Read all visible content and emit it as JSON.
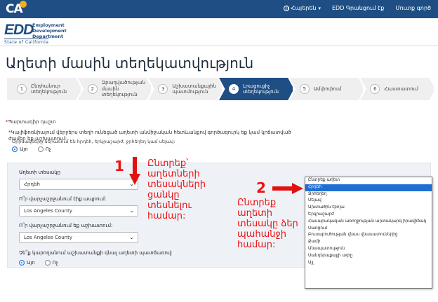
{
  "topbar": {
    "logo": "CA",
    "language": "Հայերեն",
    "my_account": "EDD Գրանցում էք",
    "login": "Մուտք գործ"
  },
  "header": {
    "edd_mark": "EDD",
    "edd_lines": [
      "Employment",
      "Development",
      "Department"
    ],
    "edd_state": "State of California"
  },
  "page": {
    "title": "Աղետի մասին տեղեկատվություն"
  },
  "steps": [
    {
      "num": "1",
      "label": "Ընդհանուր տեղեկություն",
      "active": false
    },
    {
      "num": "2",
      "label": "Զբաղվածության մասին տեղեկություն",
      "active": false
    },
    {
      "num": "3",
      "label": "Աշխատանքային պատմություն",
      "active": false
    },
    {
      "num": "4",
      "label": "Լրացուցիչ տեղեկություն",
      "active": true
    },
    {
      "num": "5",
      "label": "Ամփոփում",
      "active": false
    },
    {
      "num": "6",
      "label": "Հաստատում",
      "active": false
    }
  ],
  "form": {
    "required_note": "Պարտադիր դաշտ",
    "question1": "Կալիֆոռնիայում վերջերս տեղի ունեցած աղետի անմիջական հետևանքով գործազուրկ եք կամ կրճատված ժամեր եք աշխատում:",
    "help_text": "Օրինակները ներառում են հրդեհ, երկրաշարժ, ջրհեղեղ կամ սելավ:",
    "q1_yes": "Այո",
    "q1_no": "Ոչ",
    "disaster_type_label": "Աղետի տեսակը",
    "disaster_type_value": "Հրդեհ",
    "county_live_label": "Ո՞ր վարչաշրջանում էիք ապրում:",
    "county_live_value": "Los Angeles County",
    "county_work_label": "Ո՞ր վարչաշրջանում եք աշխատում:",
    "county_work_value": "Los Angeles County",
    "q_unable_label": "Չե՞ք կարողանում աշխատանքի գնալ աղետի պատճառով:",
    "q_unable_yes": "Այո",
    "q_unable_no": "Ոչ"
  },
  "annotations": {
    "num1": "1",
    "text1": [
      "Ընտրեք՝",
      "աղետների",
      "տեսակների",
      "ցանկը",
      "տեսնելու",
      "համար:"
    ],
    "num2": "2",
    "text2": [
      "Ընտրեք",
      "աղետի",
      "տեսակը ձեր",
      "պահանջի",
      "համար:"
    ],
    "color": "#e11111"
  },
  "dropdown": {
    "items": [
      "Ընտրեք աղետ",
      "Հրդեհ",
      "Ջրհեղեղ",
      "Սելավ",
      "Ախտածին էբոլա",
      "Երկրաշարժ",
      "Հասարակական առողջության արտակարգ իրավիճակ",
      "Սառցում",
      "Բուսաբուծության վնաս վնասատուներից",
      "Քամի",
      "Անապատություն",
      "Սանդերաքայլի ափը",
      "Այլ"
    ],
    "selected_index": 1
  }
}
